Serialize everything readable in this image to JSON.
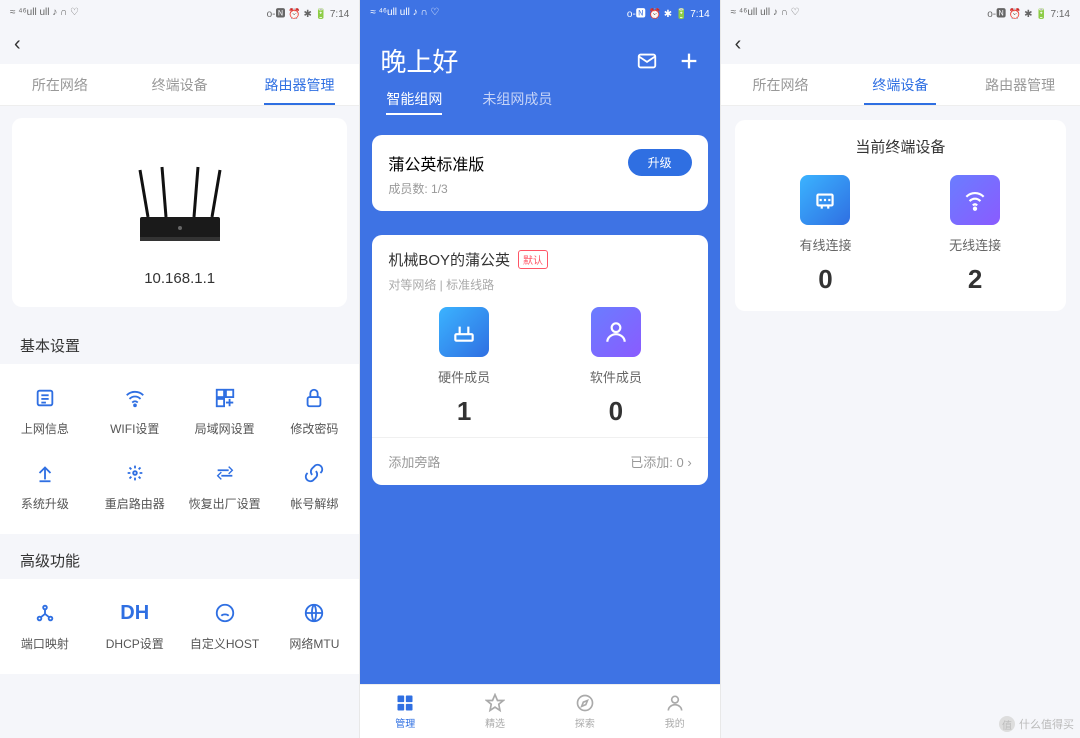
{
  "status": {
    "left": "≈ ⁴⁶ull ull ♪ ∩ ♡",
    "right": "o-🅽 ⏰ ✱ 🔋 7:14",
    "time": "7:14"
  },
  "pane1": {
    "tabs": [
      "所在网络",
      "终端设备",
      "路由器管理"
    ],
    "active": 2,
    "ip": "10.168.1.1",
    "sect1": "基本设置",
    "items1": [
      {
        "icon": "≣",
        "label": "上网信息"
      },
      {
        "icon": "wifi",
        "label": "WIFI设置"
      },
      {
        "icon": "⊞",
        "label": "局域网设置"
      },
      {
        "icon": "🔒",
        "label": "修改密码"
      },
      {
        "icon": "⇧",
        "label": "系统升级"
      },
      {
        "icon": "✳",
        "label": "重启路由器"
      },
      {
        "icon": "⇄",
        "label": "恢复出厂设置"
      },
      {
        "icon": "🔗",
        "label": "帐号解绑"
      }
    ],
    "sect2": "高级功能",
    "items2": [
      {
        "icon": "Y",
        "label": "端口映射"
      },
      {
        "icon": "DH",
        "label": "DHCP设置"
      },
      {
        "icon": "☺",
        "label": "自定义HOST"
      },
      {
        "icon": "⊕",
        "label": "网络MTU"
      }
    ]
  },
  "pane2": {
    "greeting": "晚上好",
    "btabs": [
      "智能组网",
      "未组网成员"
    ],
    "active": 0,
    "plan": "蒲公英标准版",
    "upgrade": "升级",
    "members_label": "成员数:",
    "members": "1/3",
    "netname": "机械BOY的蒲公英",
    "badge": "默认",
    "netmeta": "对等网络   |   标准线路",
    "hw_label": "硬件成员",
    "hw": "1",
    "sw_label": "软件成员",
    "sw": "0",
    "addroute": "添加旁路",
    "added_label": "已添加:",
    "added": "0",
    "nav": [
      {
        "icon": "▦",
        "label": "管理"
      },
      {
        "icon": "☆",
        "label": "精选"
      },
      {
        "icon": "◎",
        "label": "探索"
      },
      {
        "icon": "☺",
        "label": "我的"
      }
    ],
    "nav_active": 0
  },
  "pane3": {
    "tabs": [
      "所在网络",
      "终端设备",
      "路由器管理"
    ],
    "active": 1,
    "title": "当前终端设备",
    "wired_label": "有线连接",
    "wired": "0",
    "wifi_label": "无线连接",
    "wifi": "2"
  },
  "watermark": "什么值得买"
}
